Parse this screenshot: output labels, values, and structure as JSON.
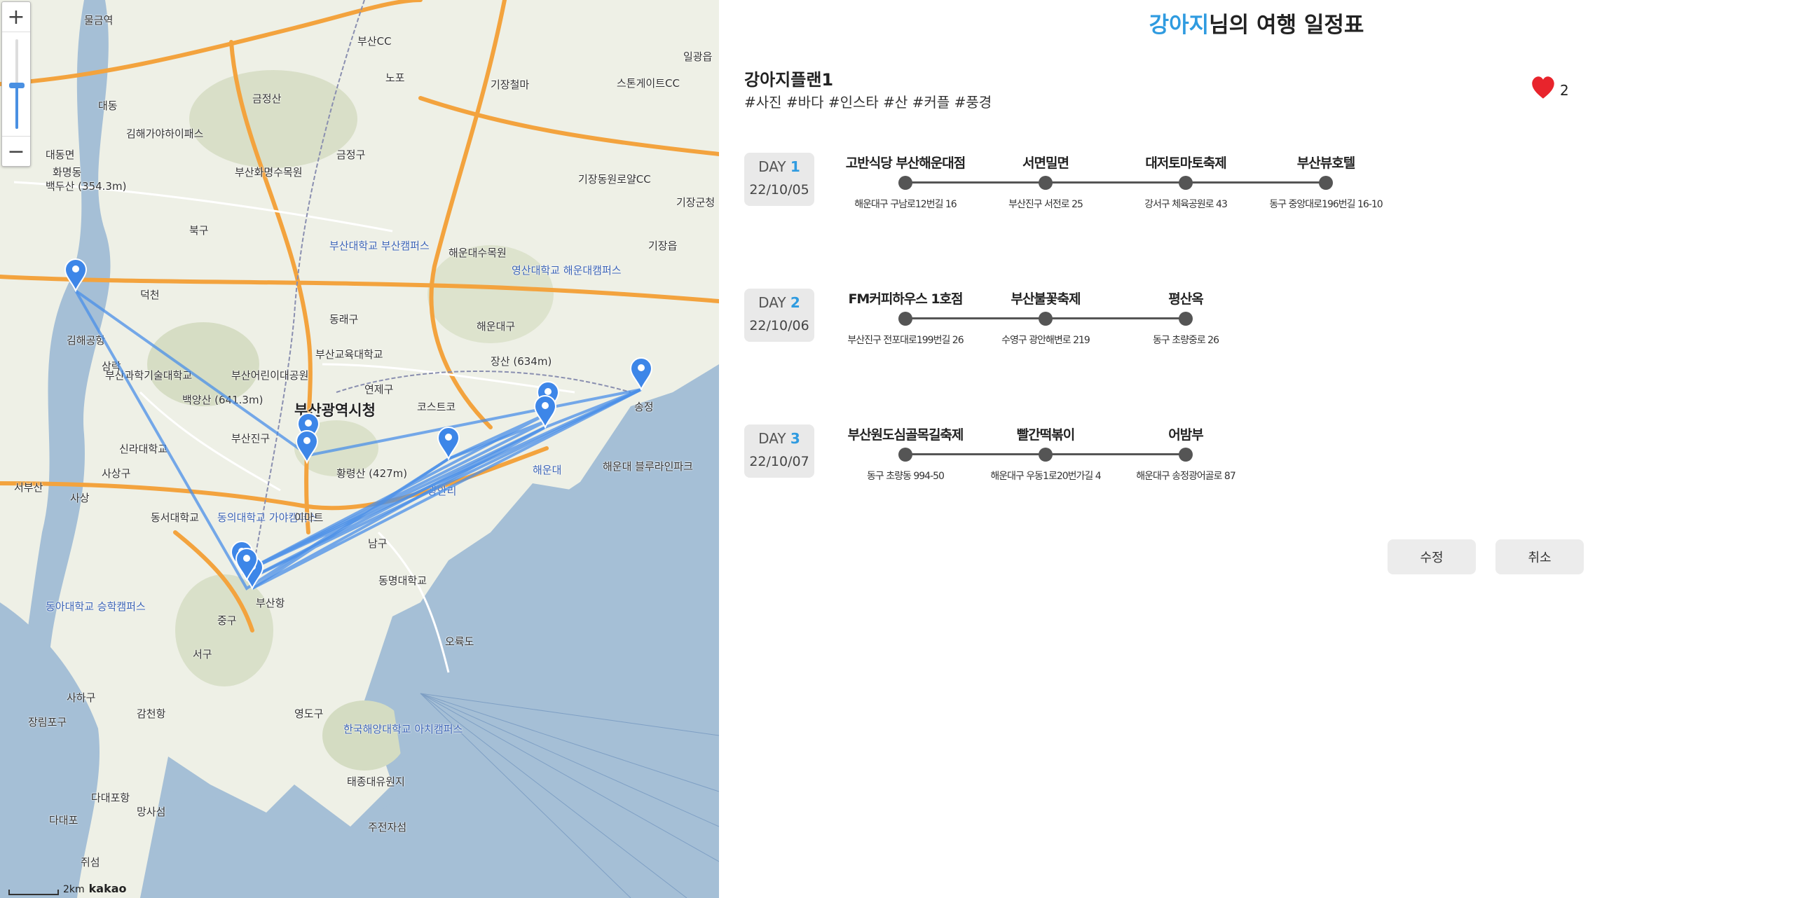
{
  "map": {
    "zoom_in_label": "+",
    "zoom_out_label": "−",
    "scale_text": "2km",
    "provider": "kakao",
    "labels": [
      {
        "text": "물금역"
      },
      {
        "text": "대동"
      },
      {
        "text": "부산CC"
      },
      {
        "text": "노포"
      },
      {
        "text": "금정산"
      },
      {
        "text": "기장철마"
      },
      {
        "text": "스톤게이트CC"
      },
      {
        "text": "일광읍"
      },
      {
        "text": "김해가야하이패스"
      },
      {
        "text": "대동면"
      },
      {
        "text": "화명동"
      },
      {
        "text": "부산화명수목원"
      },
      {
        "text": "금정구"
      },
      {
        "text": "백두산 (354.3m)"
      },
      {
        "text": "기장동원로얄CC"
      },
      {
        "text": "기장군청"
      },
      {
        "text": "북구"
      },
      {
        "text": "해운대수목원"
      },
      {
        "text": "부산대학교 부산캠퍼스"
      },
      {
        "text": "영산대학교 해운대캠퍼스"
      },
      {
        "text": "기장읍"
      },
      {
        "text": "덕천"
      },
      {
        "text": "동래구"
      },
      {
        "text": "해운대구"
      },
      {
        "text": "김해공항"
      },
      {
        "text": "부산교육대학교"
      },
      {
        "text": "장산 (634m)"
      },
      {
        "text": "삼락"
      },
      {
        "text": "부산과학기술대학교"
      },
      {
        "text": "부산어린이대공원"
      },
      {
        "text": "연제구"
      },
      {
        "text": "백양산 (641.3m)"
      },
      {
        "text": "부산광역시청"
      },
      {
        "text": "코스트코"
      },
      {
        "text": "부산진구"
      },
      {
        "text": "신라대학교"
      },
      {
        "text": "사상구"
      },
      {
        "text": "황령산 (427m)"
      },
      {
        "text": "해운대"
      },
      {
        "text": "해운대 블루라인파크"
      },
      {
        "text": "서부산"
      },
      {
        "text": "사상"
      },
      {
        "text": "동서대학교"
      },
      {
        "text": "동의대학교 가야캠퍼스"
      },
      {
        "text": "이마트"
      },
      {
        "text": "남구"
      },
      {
        "text": "동명대학교"
      },
      {
        "text": "부산항"
      },
      {
        "text": "동아대학교 승학캠퍼스"
      },
      {
        "text": "중구"
      },
      {
        "text": "서구"
      },
      {
        "text": "오륙도"
      },
      {
        "text": "사하구"
      },
      {
        "text": "장림포구"
      },
      {
        "text": "감천항"
      },
      {
        "text": "영도구"
      },
      {
        "text": "한국해양대학교 아치캠퍼스"
      },
      {
        "text": "태종대유원지"
      },
      {
        "text": "다대포항"
      },
      {
        "text": "다대포"
      },
      {
        "text": "망사섬"
      },
      {
        "text": "주전자섬"
      },
      {
        "text": "쥐섬"
      },
      {
        "text": "광안리"
      },
      {
        "text": "송정"
      }
    ]
  },
  "header": {
    "title_highlight": "강아지",
    "title_rest": "님의 여행 일정표"
  },
  "plan": {
    "name": "강아지플랜1",
    "tags": "#사진 #바다 #인스타 #산 #커플 #풍경",
    "like_count": "2"
  },
  "days": [
    {
      "prefix": "DAY ",
      "number": "1",
      "date": "22/10/05",
      "stops": [
        {
          "name": "고반식당 부산해운대점",
          "address": "해운대구 구남로12번길 16"
        },
        {
          "name": "서면밀면",
          "address": "부산진구 서전로 25"
        },
        {
          "name": "대저토마토축제",
          "address": "강서구 체육공원로 43"
        },
        {
          "name": "부산뷰호텔",
          "address": "동구 중앙대로196번길 16-10"
        }
      ]
    },
    {
      "prefix": "DAY ",
      "number": "2",
      "date": "22/10/06",
      "stops": [
        {
          "name": "FM커피하우스 1호점",
          "address": "부산진구 전포대로199번길 26"
        },
        {
          "name": "부산불꽃축제",
          "address": "수영구 광안해변로 219"
        },
        {
          "name": "평산옥",
          "address": "동구 초량중로 26"
        }
      ]
    },
    {
      "prefix": "DAY ",
      "number": "3",
      "date": "22/10/07",
      "stops": [
        {
          "name": "부산원도심골목길축제",
          "address": "동구 초량동 994-50"
        },
        {
          "name": "빨간떡볶이",
          "address": "해운대구 우동1로20번가길 4"
        },
        {
          "name": "어밤부",
          "address": "해운대구 송정광어골로 87"
        }
      ]
    }
  ],
  "buttons": {
    "edit": "수정",
    "cancel": "취소"
  },
  "colors": {
    "accent": "#2f9be0",
    "route": "#4a8fe8",
    "heart": "#e8242c"
  }
}
